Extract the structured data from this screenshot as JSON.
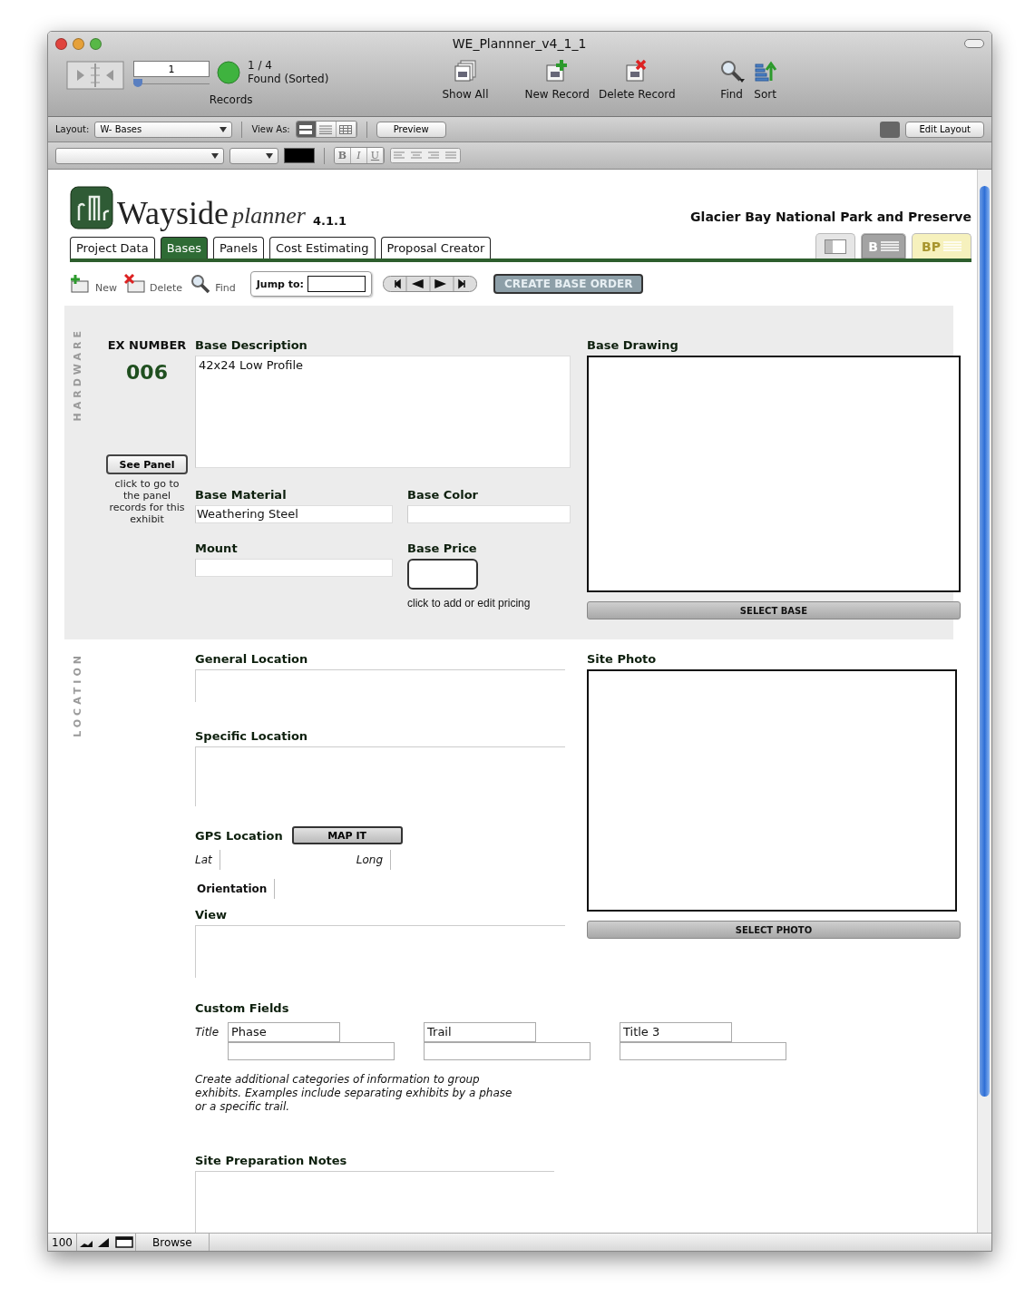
{
  "window": {
    "title": "WE_Plannner_v4_1_1"
  },
  "toolbar": {
    "record_number": "1",
    "record_slider": {
      "level": 0
    },
    "found": "1 / 4",
    "found_status": "Found (Sorted)",
    "records_label": "Records",
    "buttons": [
      {
        "label": "Show All",
        "kind": "showall"
      },
      {
        "label": "New Record",
        "kind": "new"
      },
      {
        "label": "Delete Record",
        "kind": "delete"
      },
      {
        "label": "Find",
        "kind": "find"
      },
      {
        "label": "Sort",
        "kind": "sort"
      }
    ]
  },
  "layout_bar": {
    "layout_label": "Layout:",
    "layout_value": "W- Bases",
    "view_as_label": "View As:",
    "view_modes": [
      {
        "kind": "form",
        "selected": true
      },
      {
        "kind": "list",
        "selected": false
      },
      {
        "kind": "table",
        "selected": false
      }
    ],
    "preview": "Preview",
    "edit_layout": "Edit Layout"
  },
  "format_bar": {
    "style_buttons": [
      "B",
      "I",
      "U"
    ]
  },
  "header": {
    "logo": "Wayside",
    "logo_suffix": "planner",
    "version": "4.1.1",
    "park": "Glacier Bay National Park and Preserve"
  },
  "tabs": [
    {
      "label": "Project Data",
      "selected": false
    },
    {
      "label": "Bases",
      "selected": true
    },
    {
      "label": "Panels",
      "selected": false
    },
    {
      "label": "Cost Estimating",
      "selected": false
    },
    {
      "label": "Proposal Creator",
      "selected": false
    }
  ],
  "view_switch": [
    {
      "kind": "icon",
      "selected": false,
      "color": "#e6e6e6"
    },
    {
      "kind": "text",
      "label": "B",
      "selected": true,
      "color": "#a3a3a3"
    },
    {
      "kind": "text",
      "label": "BP",
      "selected": false,
      "color": "#f6f1bd"
    }
  ],
  "actions": [
    {
      "label": "New",
      "kind": "new"
    },
    {
      "label": "Delete",
      "kind": "delete"
    },
    {
      "label": "Find",
      "kind": "find"
    }
  ],
  "jump": {
    "label": "Jump to:"
  },
  "create_order": "CREATE BASE ORDER",
  "hardware": {
    "section_label": "HARDWARE",
    "ex_number_label": "EX NUMBER",
    "ex_number": "006",
    "see_panel": "See Panel",
    "see_panel_hint": "click to go to the panel records for this exhibit",
    "description": {
      "label": "Base Description",
      "value": "42x24 Low Profile"
    },
    "material": {
      "label": "Base Material",
      "value": "Weathering Steel"
    },
    "color": {
      "label": "Base Color"
    },
    "mount": {
      "label": "Mount"
    },
    "price": {
      "label": "Base Price",
      "hint": "click to add or edit pricing"
    },
    "drawing_label": "Base Drawing",
    "select_base": "SELECT BASE"
  },
  "location": {
    "section_label": "LOCATION",
    "general_label": "General Location",
    "specific_label": "Specific Location",
    "gps_label": "GPS Location",
    "map_it": "MAP IT",
    "lat_label": "Lat",
    "long_label": "Long",
    "orientation_label": "Orientation",
    "view_label": "View",
    "photo_label": "Site Photo",
    "select_photo": "SELECT PHOTO",
    "custom_title": "Custom Fields",
    "title_label": "Title",
    "custom_fields": [
      {
        "title": "Phase"
      },
      {
        "title": "Trail"
      },
      {
        "title": "Title 3"
      }
    ],
    "custom_help": "Create additional categories of information to group exhibits. Examples include separating exhibits by a phase or a specific trail.",
    "notes_label": "Site Preparation Notes"
  },
  "status_bar": {
    "zoom": "100",
    "mode": "Browse"
  }
}
